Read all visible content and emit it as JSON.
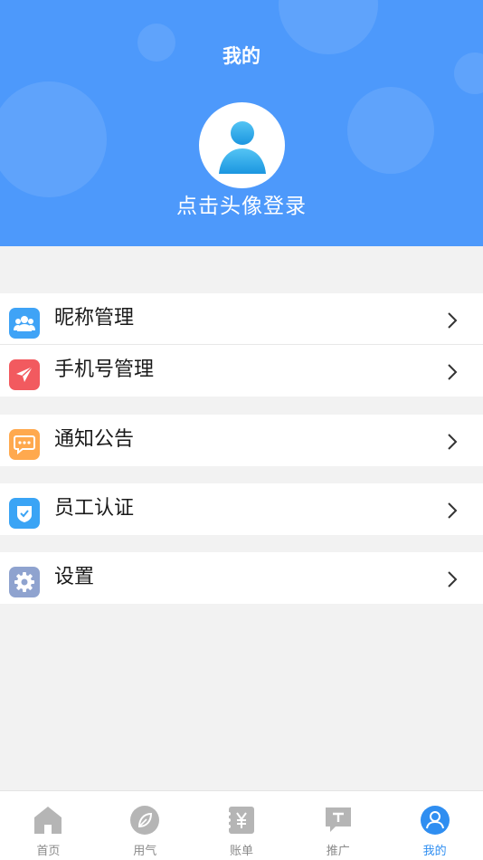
{
  "header": {
    "title": "我的",
    "login_prompt": "点击头像登录",
    "bg_color": "#4d99fb"
  },
  "menu": {
    "groups": [
      [
        {
          "label": "昵称管理",
          "icon": "users-icon",
          "color": "#3fa3f6"
        },
        {
          "label": "手机号管理",
          "icon": "paper-plane-icon",
          "color": "#f25a5f"
        }
      ],
      [
        {
          "label": "通知公告",
          "icon": "chat-bubble-icon",
          "color": "#ffa94e"
        }
      ],
      [
        {
          "label": "员工认证",
          "icon": "shield-check-icon",
          "color": "#3aa4f5"
        }
      ],
      [
        {
          "label": "设置",
          "icon": "gear-icon",
          "color": "#8fa3cf"
        }
      ]
    ]
  },
  "bottom_nav": {
    "items": [
      {
        "label": "首页",
        "icon": "home-icon",
        "active": false
      },
      {
        "label": "用气",
        "icon": "compass-leaf-icon",
        "active": false
      },
      {
        "label": "账单",
        "icon": "bill-yen-icon",
        "active": false
      },
      {
        "label": "推广",
        "icon": "promo-message-icon",
        "active": false
      },
      {
        "label": "我的",
        "icon": "user-circle-icon",
        "active": true
      }
    ],
    "active_color": "#2f8ef1",
    "inactive_color": "#b5b5b5"
  }
}
